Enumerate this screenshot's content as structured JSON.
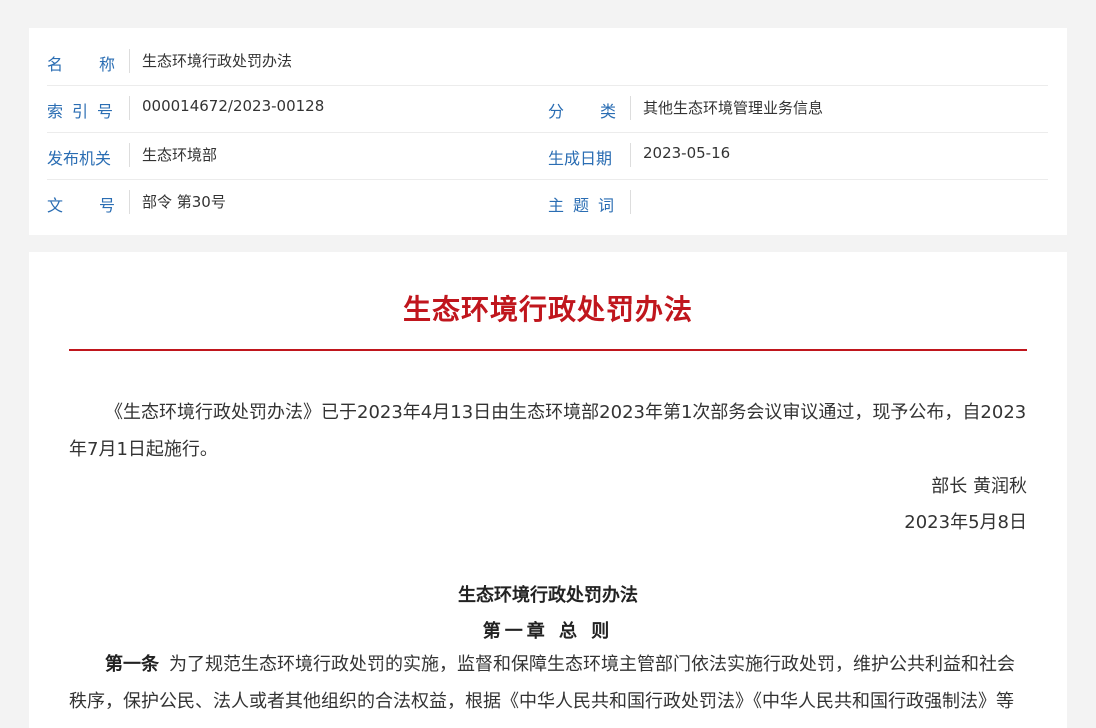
{
  "meta": {
    "name_label": "名称",
    "name_value": "生态环境行政处罚办法",
    "index_label": "索引号",
    "index_value": "000014672/2023-00128",
    "category_label": "分类",
    "category_value": "其他生态环境管理业务信息",
    "issuer_label": "发布机关",
    "issuer_value": "生态环境部",
    "date_label": "生成日期",
    "date_value": "2023-05-16",
    "docno_label": "文号",
    "docno_value": "部令 第30号",
    "topic_label": "主题词",
    "topic_value": ""
  },
  "document": {
    "title": "生态环境行政处罚办法",
    "intro": "《生态环境行政处罚办法》已于2023年4月13日由生态环境部2023年第1次部务会议审议通过，现予公布，自2023年7月1日起施行。",
    "signer": "部长 黄润秋",
    "sign_date": "2023年5月8日",
    "law_title": "生态环境行政处罚办法",
    "chapter_title": "第一章 总 则",
    "article1_label": "第一条",
    "article1_text": "为了规范生态环境行政处罚的实施，监督和保障生态环境主管部门依法实施行政处罚，维护公共利益和社会秩序，保护公民、法人或者其他组织的合法权益，根据《中华人民共和国行政处罚法》《中华人民共和国行政强制法》等法律、行政法规，制定本办法。"
  }
}
